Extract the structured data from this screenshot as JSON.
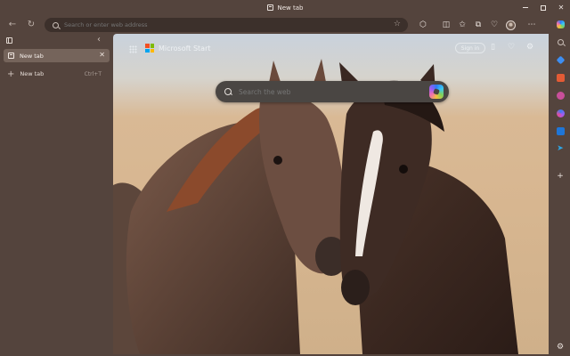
{
  "window": {
    "title": "New tab"
  },
  "toolbar": {
    "address_placeholder": "Search or enter web address",
    "icons": [
      "back-arrow-icon",
      "refresh-icon",
      "favorite-star-icon",
      "extensions-icon",
      "split-screen-icon",
      "favorites-icon",
      "collections-icon",
      "browser-essentials-icon",
      "profile-avatar",
      "more-options-icon"
    ]
  },
  "tabs_pane": {
    "active_tab_label": "New tab",
    "new_tab_label": "New tab",
    "new_tab_shortcut": "Ctrl+T"
  },
  "new_tab_page": {
    "brand": "Microsoft Start",
    "sign_in_label": "Sign in",
    "search_placeholder": "Search the web",
    "background_subject": "two horses"
  },
  "sidebar": {
    "icons": [
      "copilot-icon",
      "search-icon",
      "shopping-icon",
      "tools-icon",
      "games-icon",
      "microsoft365-icon",
      "outlook-icon",
      "telegram-icon",
      "add-icon",
      "settings-icon"
    ]
  },
  "colors": {
    "frame": "#54443d",
    "address_bar": "#3c302b",
    "active_tab": "#75645b",
    "search_box": "#4a4643"
  }
}
